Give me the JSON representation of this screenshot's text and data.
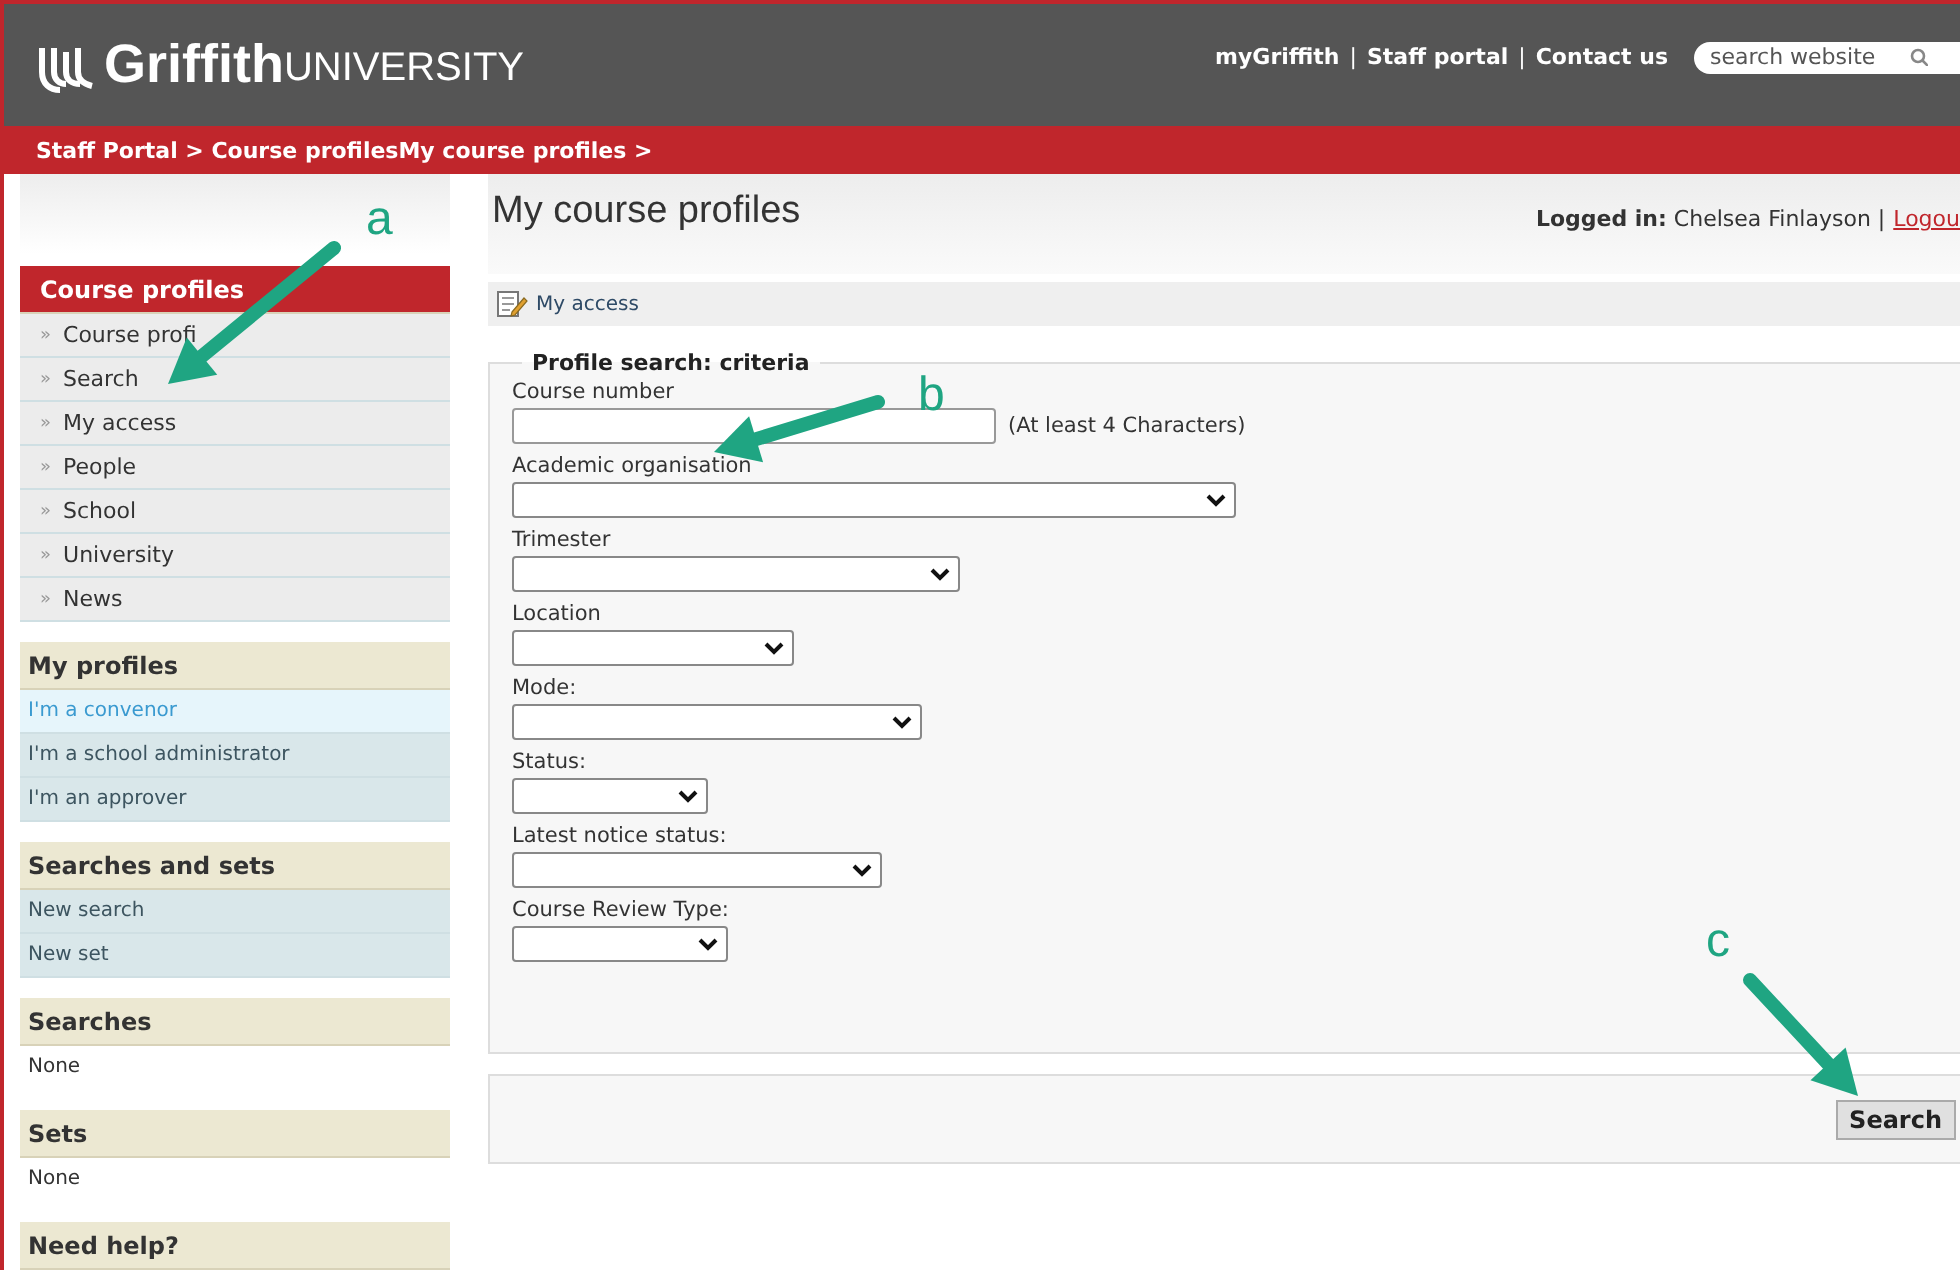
{
  "header": {
    "logo": {
      "bold": "Griffith",
      "light": "UNIVERSITY"
    },
    "links": [
      "myGriffith",
      "Staff portal",
      "Contact us"
    ],
    "separator": "|",
    "search": {
      "placeholder": "search website"
    }
  },
  "breadcrumb": "Staff Portal > Course profilesMy course profiles >",
  "sidebar": [
    {
      "title": "Course profiles",
      "kind": "primary",
      "items": [
        {
          "label": "Course profi",
          "marker": "»",
          "selected": false
        },
        {
          "label": "Search",
          "marker": "»",
          "selected": false
        },
        {
          "label": "My access",
          "marker": "»",
          "selected": false
        },
        {
          "label": "People",
          "marker": "»",
          "selected": false
        },
        {
          "label": "School",
          "marker": "»",
          "selected": false
        },
        {
          "label": "University",
          "marker": "»",
          "selected": false
        },
        {
          "label": "News",
          "marker": "»",
          "selected": false
        }
      ]
    },
    {
      "title": "My profiles",
      "kind": "link",
      "items": [
        {
          "label": "I'm a convenor",
          "selected": true
        },
        {
          "label": "I'm a school administrator",
          "selected": false
        },
        {
          "label": "I'm an approver",
          "selected": false
        }
      ]
    },
    {
      "title": "Searches and sets",
      "kind": "link",
      "items": [
        {
          "label": "New search",
          "selected": false
        },
        {
          "label": "New set",
          "selected": false
        }
      ]
    },
    {
      "title": "Searches",
      "kind": "plain",
      "items": [
        {
          "label": "None",
          "selected": false
        }
      ]
    },
    {
      "title": "Sets",
      "kind": "plain",
      "items": [
        {
          "label": "None",
          "selected": false
        }
      ]
    },
    {
      "title": "Need help?",
      "kind": "plain"
    }
  ],
  "main": {
    "title": "My course profiles",
    "logged_in": "**Logged in:** Chelsea Finlayson |",
    "logout": "Logou",
    "toolbar": {
      "link": "My access"
    },
    "form": {
      "legend": "Profile search: criteria",
      "fields": [
        {
          "label": "Course number",
          "kind": "text",
          "hint": "(At least 4 Characters)"
        },
        {
          "label": "Academic organisation",
          "kind": "select"
        },
        {
          "label": "Trimester",
          "kind": "select"
        },
        {
          "label": "Location",
          "kind": "select"
        },
        {
          "label": "Mode:",
          "kind": "select"
        },
        {
          "label": "Status:",
          "kind": "select"
        },
        {
          "label": "Latest notice status:",
          "kind": "select"
        },
        {
          "label": "Course Review Type:",
          "kind": "select"
        }
      ]
    },
    "button": "Search"
  },
  "annotations": [
    {
      "label": "a"
    },
    {
      "label": "b"
    },
    {
      "label": "c"
    }
  ]
}
